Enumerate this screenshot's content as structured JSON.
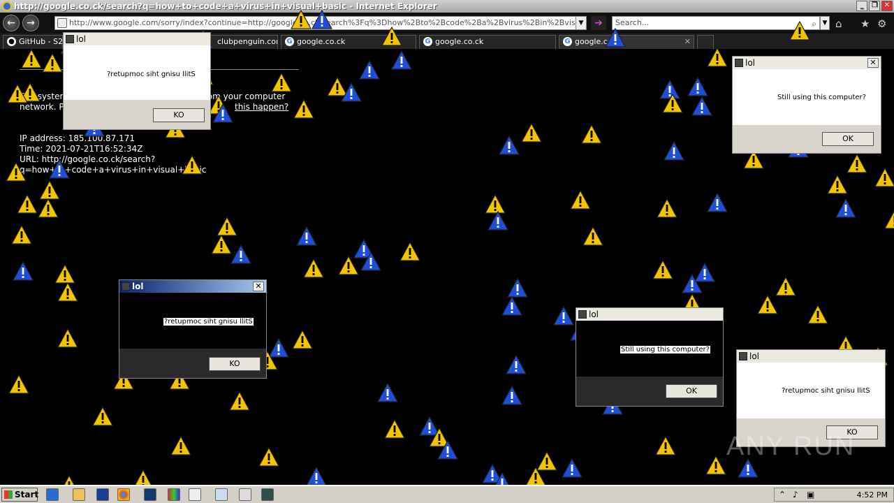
{
  "window": {
    "title": "http://google.co.ck/search?q=how+to+code+a+virus+in+visual+basic - Internet Explorer"
  },
  "nav": {
    "address": "http://www.google.com/sorry/index?continue=http://google.co.ck/search%3Fq%3Dhow%2Bto%2Bcode%2Ba%2Bvirus%2Bin%2Bvisual%2Bbasic&",
    "search_placeholder": "Search..."
  },
  "tabs": [
    {
      "label": "GitHub - S28"
    },
    {
      "label": "clubpenguin.com"
    },
    {
      "label": "google.co.ck"
    },
    {
      "label": "google.co.ck"
    },
    {
      "label": "google.co"
    }
  ],
  "page": {
    "line1": "Our systems have detected unusual traffic from your computer",
    "line2_a": "network. P",
    "line2_link": "this happen?",
    "ip": "IP address: 185.100.87.171",
    "time": "Time: 2021-07-21T16:52:34Z",
    "url1": "URL: http://google.co.ck/search?",
    "url2": "q=how+to+code+a+virus+in+visual+basic"
  },
  "dialogs": [
    {
      "title": "lol",
      "message": "?retupmoc siht gnisu llitS",
      "button": "KO"
    },
    {
      "title": "lol",
      "message": "Still using this computer?",
      "button": "OK"
    },
    {
      "title": "lol",
      "message": "?retupmoc siht gnisu llitS",
      "button": "KO"
    },
    {
      "title": "lol",
      "message": "Still using this computer?",
      "button": "OK"
    },
    {
      "title": "lol",
      "message": "?retupmoc siht gnisu llitS",
      "button": "KO"
    }
  ],
  "taskbar": {
    "start_label": "Start",
    "clock": "4:52 PM"
  },
  "watermark": "ANY RUN",
  "colors": {
    "warning_yellow": "#f5c400",
    "warning_blue": "#1f4fd8"
  }
}
